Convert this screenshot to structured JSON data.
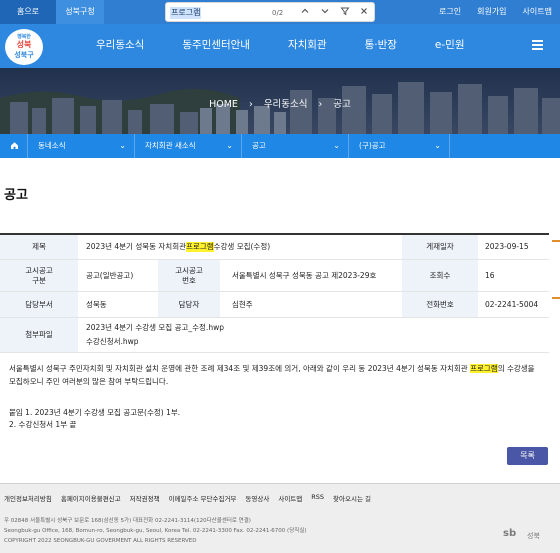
{
  "topbar": {
    "home_tab": "홈으로",
    "site_tab": "성북구청",
    "links": [
      "로그인",
      "회원가입",
      "사이트맵"
    ]
  },
  "findbar": {
    "query": "프로그램",
    "count": "0/2"
  },
  "logo": {
    "alt": "행복하세요 성북구"
  },
  "nav": [
    "우리동소식",
    "동주민센터안내",
    "자치회관",
    "통·반장",
    "e-민원"
  ],
  "breadcrumb": [
    "HOME",
    "우리동소식",
    "공고"
  ],
  "subnav": [
    "동네소식",
    "자치회관 새소식",
    "공고",
    "(구)공고"
  ],
  "page_title": "공고",
  "notice": {
    "title_label": "제목",
    "title_before": "2023년 4분기 성북동 자치회관 ",
    "title_mark": "프로그램",
    "title_after": " 수강생 모집(수정)",
    "date_label": "게재일자",
    "date": "2023-09-15",
    "category_label": "고시공고\n구분",
    "category": "공고(일반공고)",
    "number_label": "고시공고\n번호",
    "number": "서울특별시 성북구 성북동 공고 제2023-29호",
    "views_label": "조회수",
    "views": "16",
    "dept_label": "담당부서",
    "dept": "성북동",
    "person_label": "담당자",
    "person": "심현주",
    "phone_label": "전화번호",
    "phone": "02-2241-5004",
    "files_label": "첨부파일",
    "files": [
      "2023년 4분기 수강생 모집 공고_수정.hwp",
      "수강신청서.hwp"
    ]
  },
  "body": {
    "line1_before": "서울특별시 성북구 주민자치회 및 자치회관 설치 운영에 관한 조례 제34조 및 제39조에 의거, 아래와 같이 우리 동 2023년 4분기 성북동 자치회관 ",
    "line1_mark": "프로그램",
    "line1_after": "의 수강생을",
    "line2": "모집하오니 주민 여러분의 많은 참여 부탁드립니다.",
    "attach1": "붙임 1. 2023년 4분기 수강생 모집 공고문(수정) 1부.",
    "attach2": "2. 수강신청서 1부 끝"
  },
  "list_button": "목록",
  "footer": {
    "links": [
      "개인정보처리방침",
      "홈페이지이용불편신고",
      "저작권정책",
      "이메일주소 무단수집거부",
      "동영상사",
      "사이트맵",
      "RSS",
      "찾아오시는 길"
    ],
    "addr1": "우 02848 서울특별시 성북구 보문로 168(삼선동 5가) 대표전화 02-2241-3114(120다산콜센터로 연결)",
    "addr2": "Seongbuk-gu Office, 168, Bomun-ro, Seongbuk-gu, Seoul, Korea Tel. 02-2241-3300 Fax. 02-2241-6700 (당직실)",
    "addr3": "COPYRIGHT 2022 SEONGBUK-GU GOVERMENT ALL RIGHTS RESERVED",
    "brand": "sb",
    "brand_sub": "성북"
  }
}
